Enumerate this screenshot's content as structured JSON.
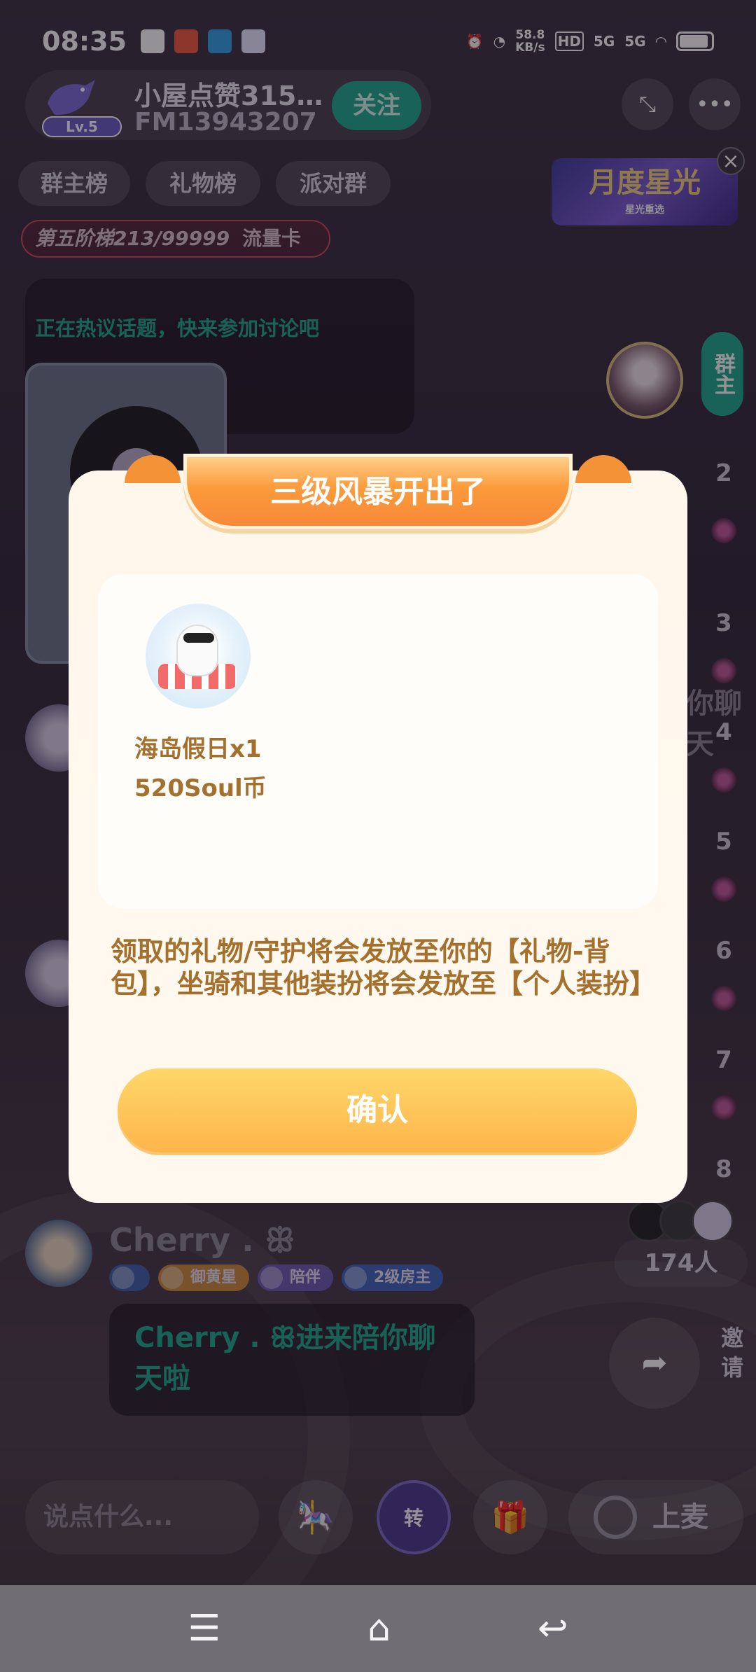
{
  "status_bar": {
    "time": "08:35",
    "net_speed_value": "58.8",
    "net_speed_unit": "KB/s",
    "hd_label": "HD",
    "signal1": "5G",
    "signal2": "5G"
  },
  "room": {
    "title": "小屋点赞315…",
    "room_id": "FM13943207",
    "level": "Lv.5",
    "follow_label": "关注"
  },
  "chips": [
    "群主榜",
    "礼物榜",
    "派对群"
  ],
  "tier": {
    "label": "第五阶梯213/99999",
    "card": "流量卡"
  },
  "starlight_banner": {
    "title": "月度星光",
    "subtitle": "星光重选"
  },
  "topic_text": "正在热议话题，快来参加讨论吧",
  "seats": {
    "group_tab": "群主",
    "numbers": [
      "2",
      "3",
      "4",
      "5",
      "6",
      "7",
      "8"
    ]
  },
  "online_count": "174人",
  "chat": {
    "user_name": "Cherry . ꕥ",
    "badges": [
      {
        "label": "御黄星",
        "color": "#c98a3a"
      },
      {
        "label": "陪伴",
        "color": "#6a5ab0"
      },
      {
        "label": "2级房主",
        "color": "#3f63b8"
      }
    ],
    "message": "Cherry . ꕥ进来陪你聊天啦"
  },
  "side_snippet": "你聊天",
  "invite_label": "邀请",
  "bottom_bar": {
    "input_placeholder": "说点什么...",
    "turn_label": "转",
    "mic_label": "上麦"
  },
  "modal": {
    "title": "三级风暴开出了",
    "gift_name": "海岛假日x1",
    "gift_price": "520Soul币",
    "note": "领取的礼物/守护将会发放至你的【礼物-背包】，坐骑和其他装扮将会发放至【个人装扮】",
    "confirm_label": "确认"
  },
  "colors": {
    "accent_green": "#1ea88a",
    "modal_bg": "#fff7ec",
    "modal_text": "#a3702e",
    "confirm_gradient_top": "#ffd76a",
    "confirm_gradient_bottom": "#fdb54a"
  }
}
